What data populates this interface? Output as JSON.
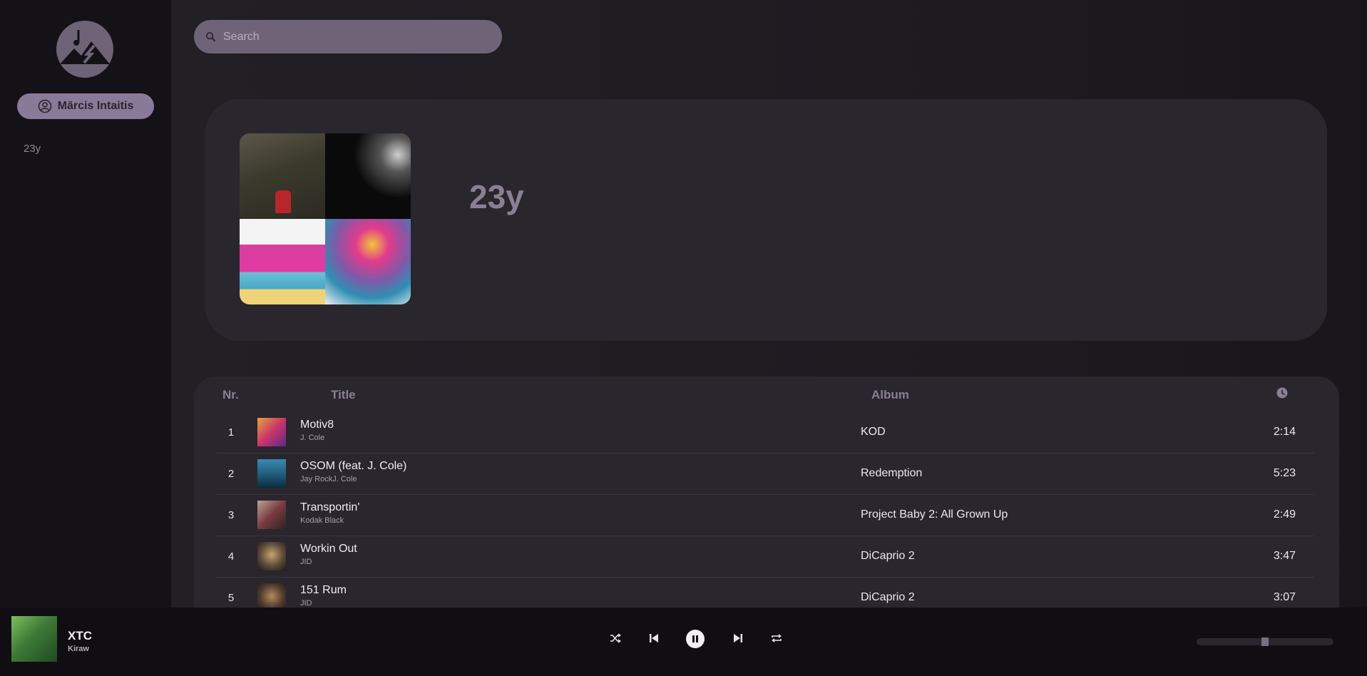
{
  "sidebar": {
    "user_name": "Mārcis Intaitis",
    "playlists": [
      {
        "label": "23y"
      }
    ]
  },
  "search": {
    "placeholder": "Search",
    "value": ""
  },
  "playlist": {
    "title": "23y"
  },
  "table": {
    "headers": {
      "nr": "Nr.",
      "title": "Title",
      "album": "Album"
    },
    "rows": [
      {
        "nr": "1",
        "title": "Motiv8",
        "artist": "J. Cole",
        "album": "KOD",
        "duration": "2:14",
        "art_color": "#c9356a"
      },
      {
        "nr": "2",
        "title": "OSOM (feat. J. Cole)",
        "artist": "Jay RockJ. Cole",
        "album": "Redemption",
        "duration": "5:23",
        "art_color": "#1f5a78"
      },
      {
        "nr": "3",
        "title": "Transportin'",
        "artist": "Kodak Black",
        "album": "Project Baby 2: All Grown Up",
        "duration": "2:49",
        "art_color": "#7a3b3f"
      },
      {
        "nr": "4",
        "title": "Workin Out",
        "artist": "JID",
        "album": "DiCaprio 2",
        "duration": "3:47",
        "art_color": "#5a4a3a"
      },
      {
        "nr": "5",
        "title": "151 Rum",
        "artist": "JID",
        "album": "DiCaprio 2",
        "duration": "3:07",
        "art_color": "#4e3b2e"
      }
    ]
  },
  "player": {
    "track_title": "XTC",
    "track_artist": "Kiraw",
    "volume": 0.5
  },
  "colors": {
    "accent": "#8a7a99",
    "sidebar_bg": "#141216",
    "card_bg": "#2a262d"
  }
}
